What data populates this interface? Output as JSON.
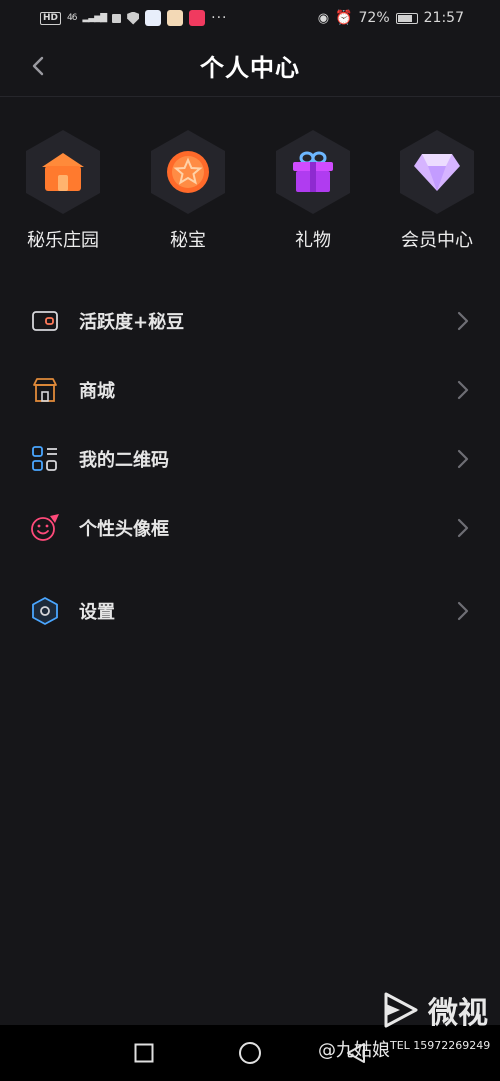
{
  "status_bar": {
    "hd": "HD",
    "network": "46",
    "dots": "···",
    "battery_pct": "72%",
    "time": "21:57"
  },
  "header": {
    "title": "个人中心"
  },
  "shortcuts": [
    {
      "label": "秘乐庄园",
      "icon": "house-icon"
    },
    {
      "label": "秘宝",
      "icon": "star-coin-icon"
    },
    {
      "label": "礼物",
      "icon": "gift-icon"
    },
    {
      "label": "会员中心",
      "icon": "diamond-icon"
    }
  ],
  "menu": [
    {
      "label": "活跃度+秘豆",
      "icon": "wallet-icon"
    },
    {
      "label": "商城",
      "icon": "store-icon"
    },
    {
      "label": "我的二维码",
      "icon": "qr-code-icon"
    },
    {
      "label": "个性头像框",
      "icon": "avatar-frame-icon"
    },
    {
      "label": "设置",
      "icon": "settings-hexagon-icon"
    }
  ],
  "watermark": {
    "app_name": "微视",
    "user": "@九姑娘",
    "tel": "TEL 15972269249"
  },
  "colors": {
    "background": "#161619",
    "hex_tile": "#25252b",
    "house_orange": "#ff7a2e",
    "coin_orange": "#ff6a2a",
    "gift_purple": "#b03cf0",
    "diamond_lilac": "#d6b4ff"
  }
}
